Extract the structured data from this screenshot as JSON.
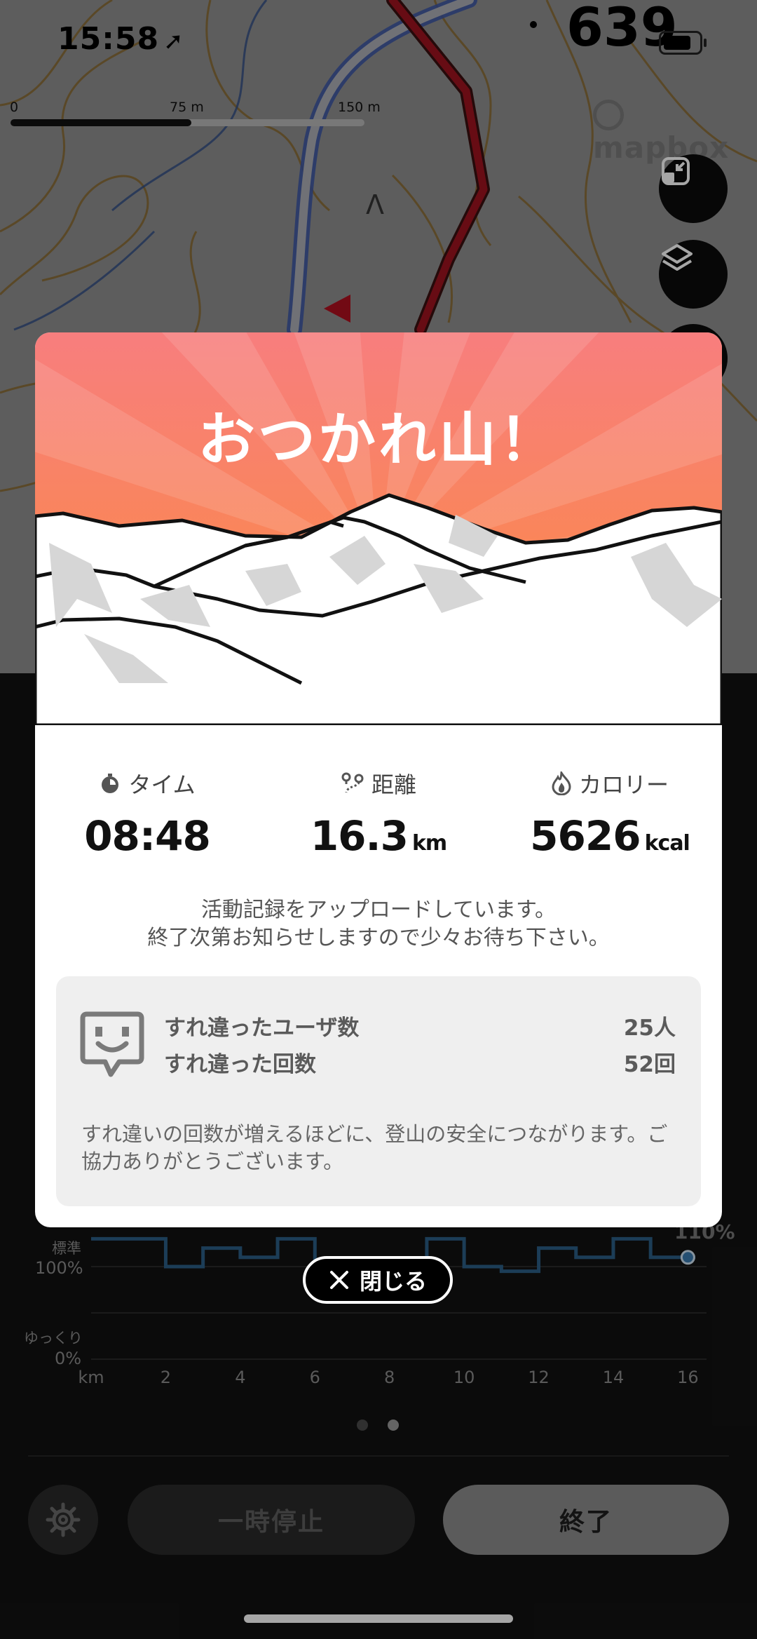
{
  "status_bar": {
    "time": "15:58",
    "side_number": "639"
  },
  "map": {
    "scale": [
      "0",
      "75 m",
      "150 m"
    ],
    "attribution": "mapbox",
    "terrain_label": "Λ",
    "buttons": [
      {
        "icon": "collapse-icon"
      },
      {
        "icon": "layers-icon"
      }
    ]
  },
  "pace_chart": {
    "left_labels": [
      {
        "name": "standard-label",
        "text": "標準"
      },
      {
        "name": "standard-percent",
        "text": "100%"
      },
      {
        "name": "slow-label",
        "text": "ゆっくり"
      },
      {
        "name": "slow-percent",
        "text": "0%"
      }
    ],
    "right_value": "110%",
    "x_unit": "km",
    "x_ticks": [
      "2",
      "4",
      "6",
      "8",
      "10",
      "12",
      "14",
      "16"
    ],
    "chart_data": {
      "type": "line",
      "x": [
        0,
        1,
        2,
        3,
        4,
        5,
        6,
        7,
        8,
        9,
        10,
        11,
        12,
        13,
        14,
        15,
        16
      ],
      "y": [
        130,
        130,
        100,
        120,
        110,
        130,
        100,
        100,
        100,
        130,
        100,
        95,
        120,
        110,
        130,
        110,
        110
      ],
      "xlabel": "km",
      "ylabel": "",
      "xlim": [
        0,
        16.5
      ],
      "ylim": [
        0,
        150
      ],
      "color": "#2c5f86"
    }
  },
  "pager": {
    "count": 2,
    "active": 1
  },
  "controls": {
    "settings_icon": "gear-icon",
    "pause_label": "一時停止",
    "end_label": "終了"
  },
  "modal": {
    "title": "おつかれ山！",
    "stats": [
      {
        "name": "time",
        "icon": "stopwatch-icon",
        "label": "タイム",
        "value": "08:48",
        "unit": ""
      },
      {
        "name": "distance",
        "icon": "route-icon",
        "label": "距離",
        "value": "16.3",
        "unit": "km"
      },
      {
        "name": "calories",
        "icon": "flame-icon",
        "label": "カロリー",
        "value": "5626",
        "unit": "kcal"
      }
    ],
    "upload_message_1": "活動記録をアップロードしています。",
    "upload_message_2": "終了次第お知らせしますので少々お待ち下さい。",
    "encounters": {
      "icon": "happy-face-chat-icon",
      "users_label": "すれ違ったユーザ数",
      "users_value": "25人",
      "count_label": "すれ違った回数",
      "count_value": "52回",
      "note": "すれ違いの回数が増えるほどに、登山の安全につながります。ご協力ありがとうございます。"
    },
    "close_label": "閉じる",
    "colors": {
      "sky_top": "#f87e7e",
      "sky_bottom": "#fb8c3a"
    }
  }
}
